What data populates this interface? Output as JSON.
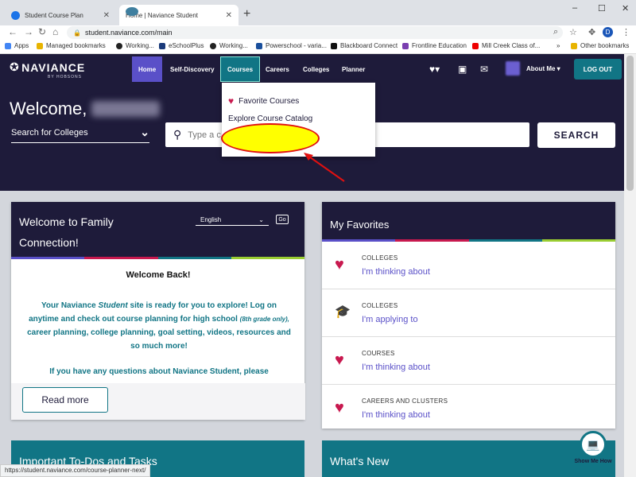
{
  "browser": {
    "tabs": [
      {
        "title": "Student Course Plan",
        "active": false
      },
      {
        "title": "Home | Naviance Student",
        "active": true
      }
    ],
    "new_tab": "+",
    "window_controls": [
      "–",
      "☐",
      "✕"
    ],
    "url": "student.naviance.com/main",
    "bookmarks": [
      {
        "label": "Apps",
        "icon": "apps-icon"
      },
      {
        "label": "Managed bookmarks",
        "icon": "folder-icon"
      },
      {
        "label": "Working...",
        "icon": "github-icon"
      },
      {
        "label": "eSchoolPlus",
        "icon": "esp-icon"
      },
      {
        "label": "Working...",
        "icon": "github-icon"
      },
      {
        "label": "Powerschool - varia...",
        "icon": "powerschool-icon"
      },
      {
        "label": "Blackboard Connect",
        "icon": "blackboard-icon"
      },
      {
        "label": "Frontline Education",
        "icon": "frontline-icon"
      },
      {
        "label": "Mill Creek Class of...",
        "icon": "youtube-icon"
      }
    ],
    "more": "»",
    "other_bookmarks": "Other bookmarks",
    "profile_initial": "D",
    "status_url": "https://student.naviance.com/course-planner-next/"
  },
  "header": {
    "logo_text": "NAVIANCE",
    "logo_sub": "BY HOBSONS",
    "nav": [
      {
        "label": "Home",
        "state": "active"
      },
      {
        "label": "Self-Discovery",
        "state": "normal"
      },
      {
        "label": "Courses",
        "state": "open"
      },
      {
        "label": "Careers",
        "state": "normal"
      },
      {
        "label": "Colleges",
        "state": "normal"
      },
      {
        "label": "Planner",
        "state": "normal"
      }
    ],
    "about_me": "About Me ▾",
    "logout": "LOG OUT"
  },
  "hero": {
    "welcome": "Welcome,",
    "search_category": "Search for Colleges",
    "search_placeholder": "Type a c",
    "search_button": "SEARCH"
  },
  "courses_menu": {
    "items": [
      "Favorite Courses",
      "Explore Course Catalog"
    ]
  },
  "family_card": {
    "title_line1": "Welcome to Family",
    "title_line2": "Connection!",
    "language": "English",
    "go": "Go",
    "welcome_back": "Welcome Back!",
    "message_l1a": "Your Naviance ",
    "message_l1b": "Student",
    "message_l1c": " site is ready for you to explore! Log on",
    "message_l2a": "anytime and check out course planning for high school ",
    "message_l2b": "(8th grade only),",
    "message_l3": "career planning, college planning, goal setting, videos, resources and",
    "message_l4": "so much more!",
    "message_cut": "If you have any questions about Naviance Student, please",
    "read_more": "Read more"
  },
  "favorites": {
    "title": "My Favorites",
    "rows": [
      {
        "category": "COLLEGES",
        "link": "I'm thinking about",
        "icon": "heart-icon"
      },
      {
        "category": "COLLEGES",
        "link": "I'm applying to",
        "icon": "graduation-cap-icon"
      },
      {
        "category": "COURSES",
        "link": "I'm thinking about",
        "icon": "heart-icon"
      },
      {
        "category": "CAREERS AND CLUSTERS",
        "link": "I'm thinking about",
        "icon": "heart-icon"
      }
    ]
  },
  "bottom": {
    "todos": "Important To-Dos and Tasks",
    "whats_new": "What's New",
    "show_me_how": "Show Me How"
  },
  "colors": {
    "navy": "#1e1b3a",
    "teal": "#117585",
    "purple": "#5a50c8",
    "magenta": "#c8194f",
    "stripe": [
      "#5a50c8",
      "#c8194f",
      "#117585",
      "#9acd32"
    ]
  }
}
